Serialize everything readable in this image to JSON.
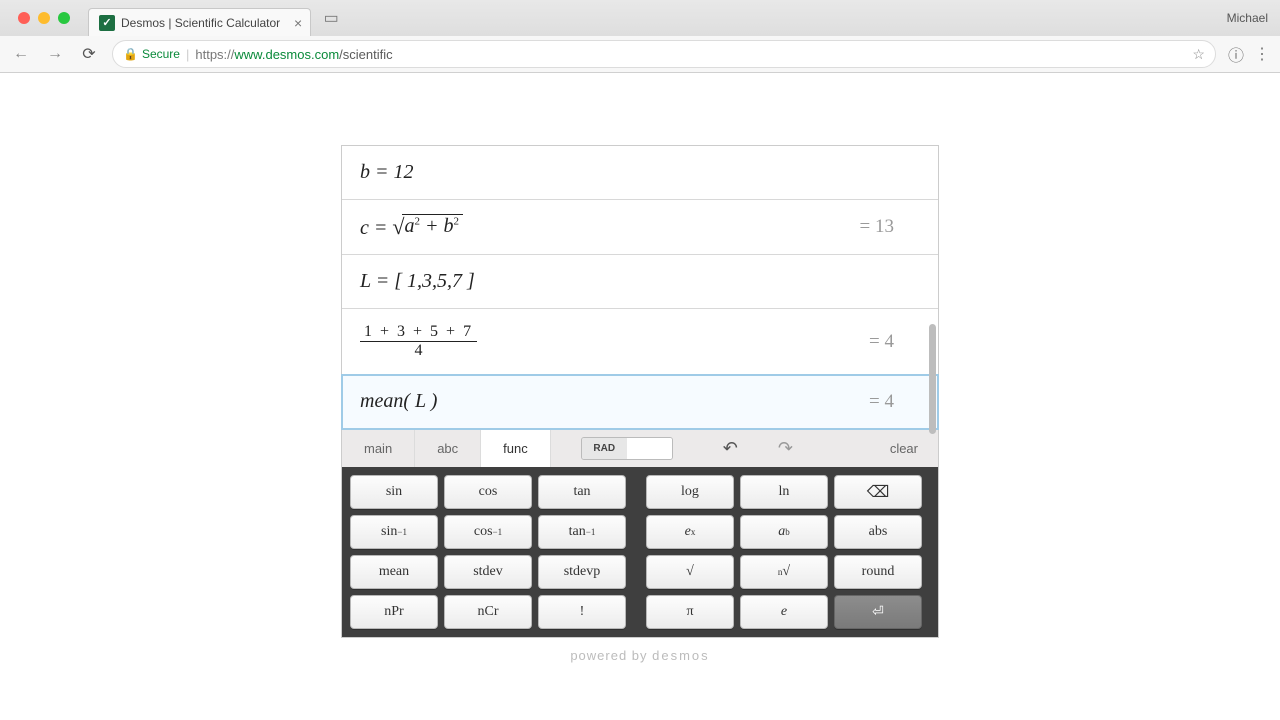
{
  "browser": {
    "tab_title": "Desmos | Scientific Calculator",
    "profile": "Michael",
    "secure_label": "Secure",
    "url_prefix": "https://",
    "url_host": "www.desmos.com",
    "url_path": "/scientific"
  },
  "expressions": [
    {
      "display_html": "<span class='math-it'>b</span> = 12",
      "result": ""
    },
    {
      "display_html": "<span class='math-it'>c</span> = <span class='sqrt'><span class='sqrt-sym'>√</span><span class='sqrt-body'><span class='math-it'>a</span><span class='sup'>2</span> + <span class='math-it'>b</span><span class='sup'>2</span></span></span>",
      "result": "= 13"
    },
    {
      "display_html": "<span class='math-it'>L</span> = [ 1,3,5,7 ]",
      "result": ""
    },
    {
      "display_html": "<span class='frac'><span class='num'>1 + 3 + 5 + 7</span><span class='den'>4</span></span>",
      "result": "= 4"
    },
    {
      "display_html": "mean( <span class='math-it'>L</span> )",
      "result": "= 4",
      "active": true
    }
  ],
  "kbd_tabs": {
    "main": "main",
    "abc": "abc",
    "func": "func",
    "rad": "RAD",
    "clear": "clear"
  },
  "keys_left": [
    "sin",
    "cos",
    "tan",
    "sin⁻¹",
    "cos⁻¹",
    "tan⁻¹",
    "mean",
    "stdev",
    "stdevp",
    "nPr",
    "nCr",
    "!"
  ],
  "keys_right": [
    {
      "html": "log"
    },
    {
      "html": "ln"
    },
    {
      "html": "⌫",
      "cls": "backspace"
    },
    {
      "html": "<span class='math-it'>e</span><span class='sup'>x</span>"
    },
    {
      "html": "<span class='math-it'>a</span><span class='sup'>b</span>"
    },
    {
      "html": "abs"
    },
    {
      "html": "√"
    },
    {
      "html": "<span class='sup'>n</span>√"
    },
    {
      "html": "round"
    },
    {
      "html": "π"
    },
    {
      "html": "<span class='math-it'>e</span>"
    },
    {
      "html": "⏎",
      "cls": "dark"
    }
  ],
  "footer": {
    "prefix": "powered by ",
    "brand": "desmos"
  }
}
